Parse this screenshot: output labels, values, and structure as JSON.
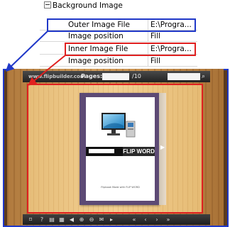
{
  "properties": {
    "category": "Background Image",
    "rows": [
      {
        "name": "Outer Image File",
        "value": "E:\\Progra..."
      },
      {
        "name": "Image position",
        "value": "Fill"
      },
      {
        "name": "Inner Image File",
        "value": "E:\\Progra..."
      },
      {
        "name": "Image position",
        "value": "Fill"
      }
    ]
  },
  "viewer": {
    "url": "www.flipbuilder.com",
    "pages_label": "Pages:",
    "page_total": "/10",
    "book": {
      "brand": "FLIP WORD",
      "caption": "Flipbook Made with FLIP WORD"
    },
    "toolbar_icons": [
      "fit-icon",
      "help-icon",
      "print-icon",
      "thumbnails-icon",
      "sound-icon",
      "zoom-in-icon",
      "zoom-out-icon",
      "share-icon",
      "play-icon",
      "first-page-icon",
      "prev-page-icon",
      "next-page-icon",
      "last-page-icon"
    ]
  },
  "colors": {
    "outer_highlight": "#2038c8",
    "inner_highlight": "#e02020"
  }
}
